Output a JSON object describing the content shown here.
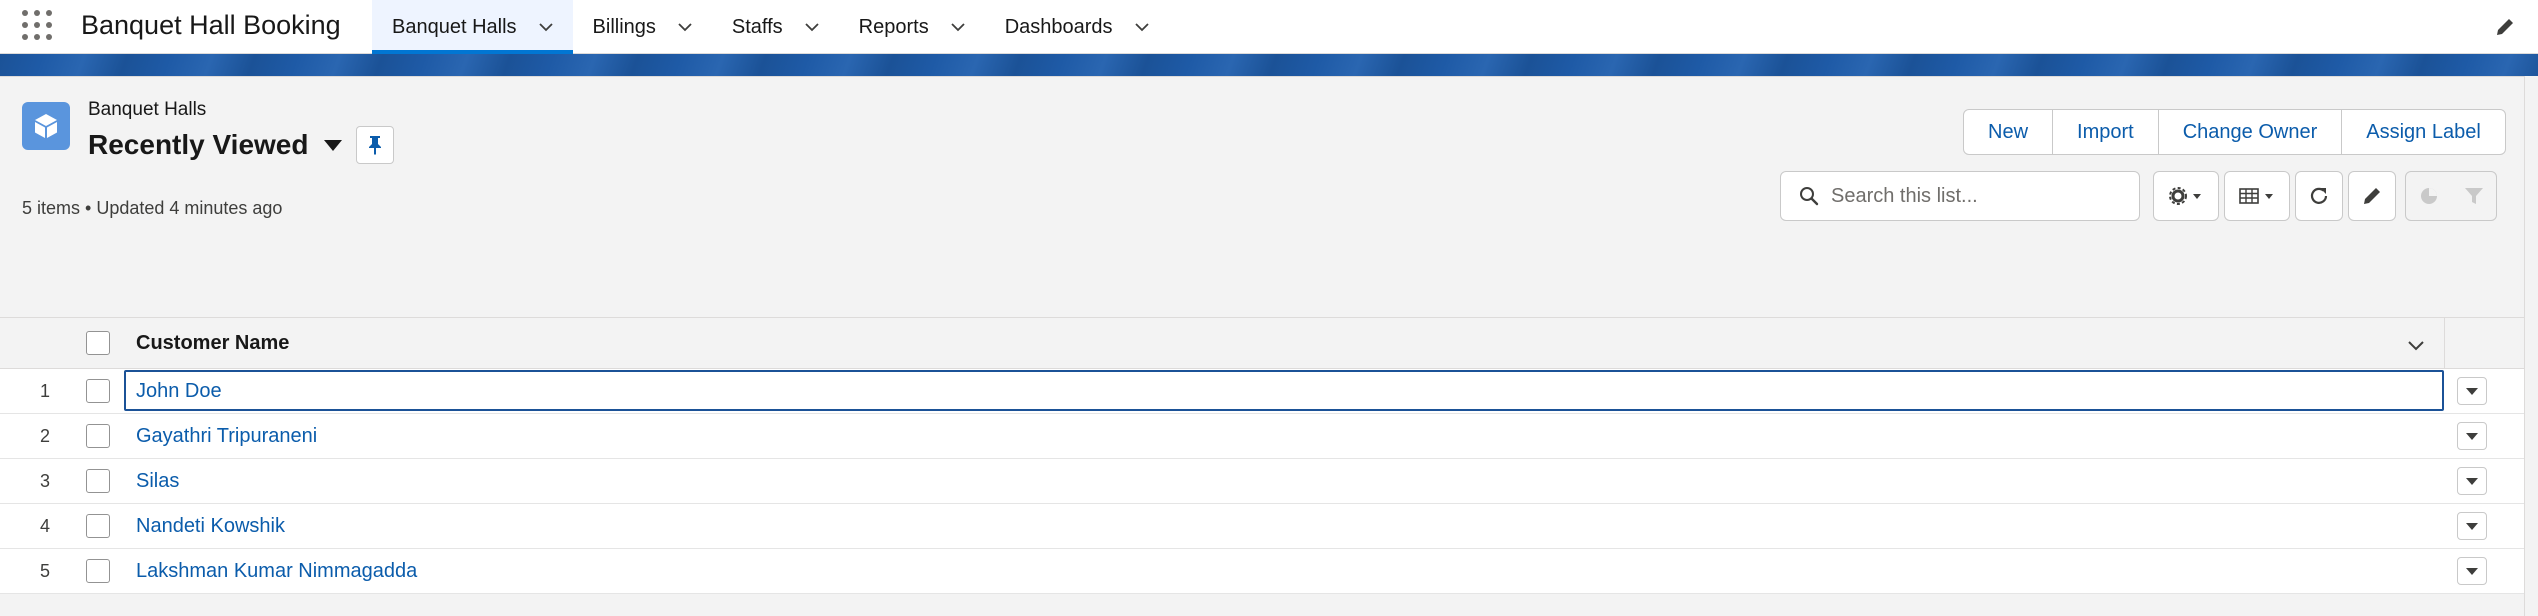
{
  "app": {
    "name": "Banquet Hall Booking"
  },
  "nav": {
    "tabs": [
      {
        "label": "Banquet Halls",
        "active": true
      },
      {
        "label": "Billings",
        "active": false
      },
      {
        "label": "Staffs",
        "active": false
      },
      {
        "label": "Reports",
        "active": false
      },
      {
        "label": "Dashboards",
        "active": false
      }
    ]
  },
  "list_header": {
    "object_label": "Banquet Halls",
    "view_name": "Recently Viewed",
    "meta": "5 items • Updated 4 minutes ago"
  },
  "actions": {
    "buttons": [
      "New",
      "Import",
      "Change Owner",
      "Assign Label"
    ]
  },
  "search": {
    "placeholder": "Search this list..."
  },
  "table": {
    "columns": [
      "Customer Name"
    ],
    "rows": [
      {
        "num": "1",
        "name": "John Doe"
      },
      {
        "num": "2",
        "name": "Gayathri Tripuraneni"
      },
      {
        "num": "3",
        "name": "Silas"
      },
      {
        "num": "4",
        "name": "Nandeti Kowshik"
      },
      {
        "num": "5",
        "name": "Lakshman Kumar Nimmagadda"
      }
    ]
  },
  "colors": {
    "brand": "#0176d3",
    "link": "#0b5cab",
    "banner": "#1b5297",
    "object_icon": "#5a95dd"
  }
}
